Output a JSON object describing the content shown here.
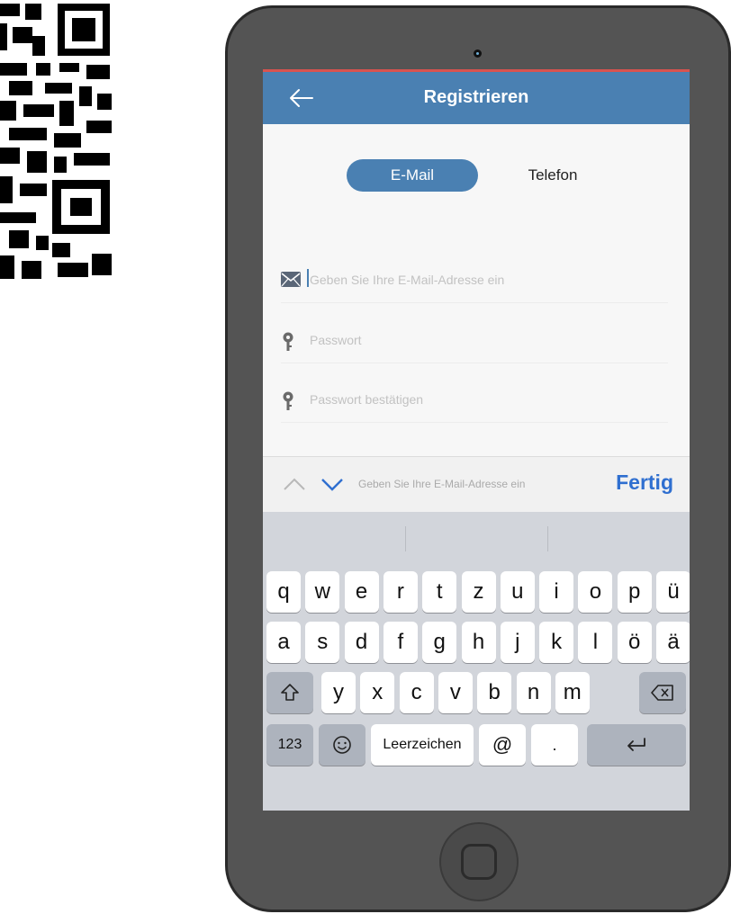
{
  "nav": {
    "title": "Registrieren"
  },
  "tabs": {
    "email": "E-Mail",
    "phone": "Telefon"
  },
  "fields": {
    "email_placeholder": "Geben Sie Ihre E-Mail-Adresse ein",
    "password_placeholder": "Passwort",
    "confirm_placeholder": "Passwort bestätigen"
  },
  "accessory": {
    "hint": "Geben Sie Ihre E-Mail-Adresse ein",
    "done": "Fertig"
  },
  "keyboard": {
    "row1": [
      "q",
      "w",
      "e",
      "r",
      "t",
      "z",
      "u",
      "i",
      "o",
      "p",
      "ü"
    ],
    "row2": [
      "a",
      "s",
      "d",
      "f",
      "g",
      "h",
      "j",
      "k",
      "l",
      "ö",
      "ä"
    ],
    "row3": [
      "y",
      "x",
      "c",
      "v",
      "b",
      "n",
      "m"
    ],
    "numbers": "123",
    "space": "Leerzeichen",
    "at": "@",
    "dot": "."
  },
  "colors": {
    "accent": "#4a80b2",
    "done": "#2f6fd0",
    "top_stripe": "#d9534f"
  }
}
